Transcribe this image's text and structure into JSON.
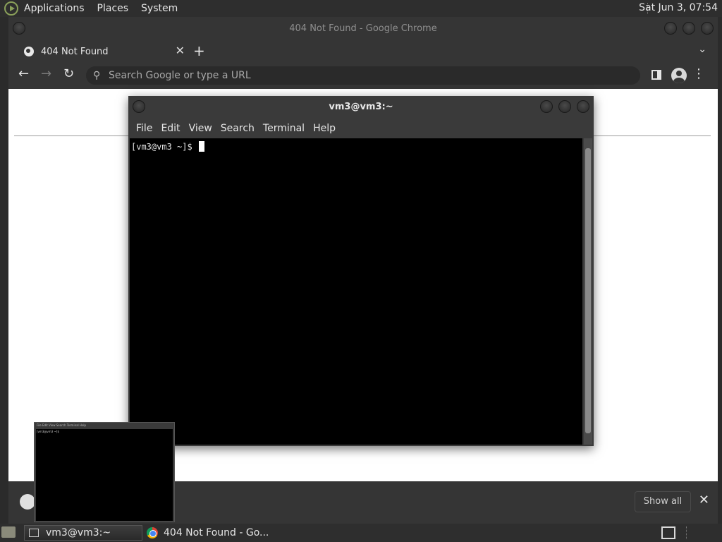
{
  "top_panel": {
    "menus": [
      "Applications",
      "Places",
      "System"
    ],
    "clock": "Sat Jun  3, 07:54"
  },
  "chrome": {
    "window_title": "404 Not Found - Google Chrome",
    "tab": {
      "title": "404 Not Found",
      "close": "✕"
    },
    "new_tab": "+",
    "omnibox": {
      "placeholder": "Search Google or type a URL"
    },
    "toolbar": {
      "back": "←",
      "forward": "→",
      "reload": "↻",
      "menu": "⋮"
    },
    "download_bar": {
      "show_all": "Show all",
      "close": "✕"
    }
  },
  "terminal": {
    "title": "vm3@vm3:~",
    "menu": [
      "File",
      "Edit",
      "View",
      "Search",
      "Terminal",
      "Help"
    ],
    "prompt": "[vm3@vm3 ~]$ "
  },
  "thumbnail": {
    "menu": "File   Edit   View   Search   Terminal   Help",
    "prompt": "[vm3@vm3 ~]$"
  },
  "taskbar": {
    "items": [
      {
        "label": "vm3@vm3:~"
      },
      {
        "label": "404 Not Found - Go..."
      }
    ]
  }
}
